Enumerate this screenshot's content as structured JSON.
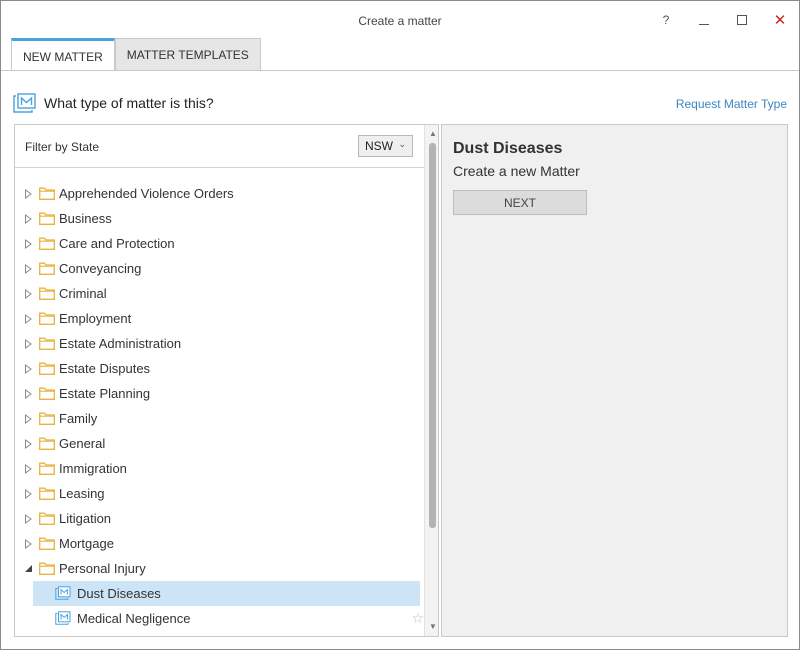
{
  "window": {
    "title": "Create a matter",
    "help": "?",
    "close": "✕"
  },
  "tabs": [
    {
      "label": "NEW MATTER",
      "active": true
    },
    {
      "label": "MATTER TEMPLATES",
      "active": false
    }
  ],
  "header": {
    "title": "What type of matter is this?",
    "request_link": "Request Matter Type"
  },
  "filter": {
    "label": "Filter by State",
    "selected_state": "NSW"
  },
  "tree": {
    "categories": [
      {
        "label": "Apprehended Violence Orders"
      },
      {
        "label": "Business"
      },
      {
        "label": "Care and Protection"
      },
      {
        "label": "Conveyancing"
      },
      {
        "label": "Criminal"
      },
      {
        "label": "Employment"
      },
      {
        "label": "Estate Administration"
      },
      {
        "label": "Estate Disputes"
      },
      {
        "label": "Estate Planning"
      },
      {
        "label": "Family"
      },
      {
        "label": "General"
      },
      {
        "label": "Immigration"
      },
      {
        "label": "Leasing"
      },
      {
        "label": "Litigation"
      },
      {
        "label": "Mortgage"
      },
      {
        "label": "Personal Injury"
      }
    ],
    "expanded_children": [
      {
        "label": "Dust Diseases",
        "selected": true
      },
      {
        "label": "Medical Negligence",
        "selected": false
      }
    ],
    "star_glyph": "☆"
  },
  "detail": {
    "title": "Dust Diseases",
    "subtitle": "Create a new Matter",
    "next_label": "NEXT"
  },
  "colors": {
    "accent": "#4aa3df",
    "link": "#3c86c6",
    "selection": "#cde3f6",
    "folder": "#e8b33c",
    "close": "#c42b1c"
  }
}
